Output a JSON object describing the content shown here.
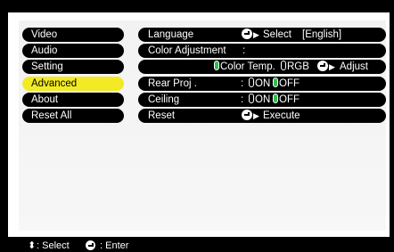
{
  "menu": {
    "items": [
      {
        "label": "Video",
        "active": false
      },
      {
        "label": "Audio",
        "active": false
      },
      {
        "label": "Setting",
        "active": false
      },
      {
        "label": "Advanced",
        "active": true
      },
      {
        "label": "About",
        "active": false
      },
      {
        "label": "Reset All",
        "active": false
      }
    ]
  },
  "settings": {
    "language": {
      "label": "Language",
      "action": "Select",
      "value": "[English]"
    },
    "color_adjustment": {
      "label": "Color Adjustment",
      "sep": ":"
    },
    "color_options": {
      "opt1": "Color Temp.",
      "opt2": "RGB",
      "action": "Adjust"
    },
    "rear_proj": {
      "label": "Rear Proj .",
      "sep": ":",
      "on": "ON",
      "off": "OFF"
    },
    "ceiling": {
      "label": "Ceiling",
      "sep": ":",
      "on": "ON",
      "off": "OFF"
    },
    "reset": {
      "label": "Reset",
      "action": "Execute"
    }
  },
  "status": {
    "select": ": Select",
    "enter": ": Enter"
  },
  "colors": {
    "active_menu": "#f2ea24",
    "selected_bullet": "#2fbf4f"
  }
}
